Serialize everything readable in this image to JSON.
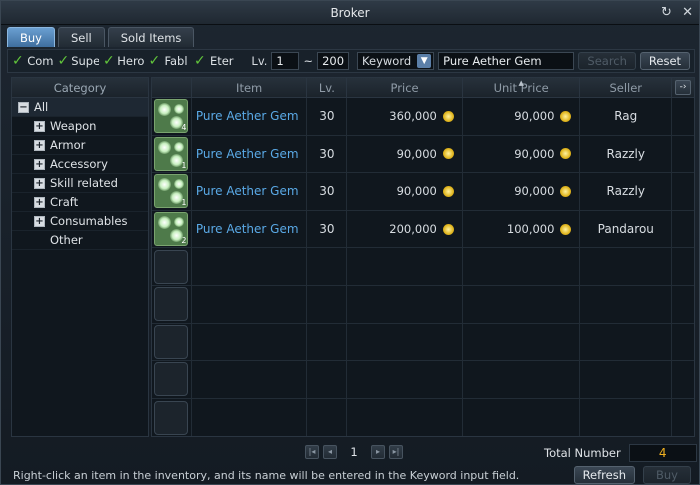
{
  "window": {
    "title": "Broker",
    "ctrl_restore": "↻",
    "ctrl_close": "✕"
  },
  "tabs": [
    {
      "label": "Buy",
      "active": true
    },
    {
      "label": "Sell",
      "active": false
    },
    {
      "label": "Sold Items",
      "active": false
    }
  ],
  "filters": {
    "checkboxes": [
      {
        "label": "Com",
        "checked": true
      },
      {
        "label": "Supe",
        "checked": true
      },
      {
        "label": "Hero",
        "checked": true
      },
      {
        "label": "Fabl",
        "checked": true
      },
      {
        "label": "Eter",
        "checked": true
      }
    ],
    "lv_label": "Lv.",
    "lv_min": "1",
    "lv_sep": "~",
    "lv_max": "200",
    "search_type": "Keyword",
    "keyword": "Pure Aether Gem",
    "search_label": "Search",
    "reset_label": "Reset"
  },
  "category": {
    "header": "Category",
    "items": [
      {
        "label": "All",
        "toggle": "−"
      },
      {
        "label": "Weapon",
        "toggle": "+"
      },
      {
        "label": "Armor",
        "toggle": "+"
      },
      {
        "label": "Accessory",
        "toggle": "+"
      },
      {
        "label": "Skill related",
        "toggle": "+"
      },
      {
        "label": "Craft",
        "toggle": "+"
      },
      {
        "label": "Consumables",
        "toggle": "+"
      },
      {
        "label": "Other",
        "toggle": ""
      }
    ]
  },
  "table": {
    "columns": {
      "item": "Item",
      "lv": "Lv.",
      "price": "Price",
      "unit_price": "Unit Price",
      "seller": "Seller",
      "more": "-›"
    },
    "rows": [
      {
        "icon": "aether-gem-icon",
        "qty": "4",
        "item": "Pure Aether Gem",
        "lv": "30",
        "price": "360,000",
        "unit_price": "90,000",
        "seller": "Rag"
      },
      {
        "icon": "aether-gem-icon",
        "qty": "1",
        "item": "Pure Aether Gem",
        "lv": "30",
        "price": "90,000",
        "unit_price": "90,000",
        "seller": "Razzly"
      },
      {
        "icon": "aether-gem-icon",
        "qty": "1",
        "item": "Pure Aether Gem",
        "lv": "30",
        "price": "90,000",
        "unit_price": "90,000",
        "seller": "Razzly"
      },
      {
        "icon": "aether-gem-icon",
        "qty": "2",
        "item": "Pure Aether Gem",
        "lv": "30",
        "price": "200,000",
        "unit_price": "100,000",
        "seller": "Pandarou"
      }
    ],
    "empty_rows": 5
  },
  "pager": {
    "first": "|◂",
    "prev": "◂",
    "page": "1",
    "next": "▸",
    "last": "▸|"
  },
  "total": {
    "label": "Total Number",
    "value": "4"
  },
  "hint": "Right-click an item in the inventory, and its name will be entered in the Keyword input field.",
  "buttons": {
    "refresh": "Refresh",
    "buy": "Buy"
  },
  "colors": {
    "item_link": "#5aa9e6",
    "total_value": "#f0b020",
    "check": "#61c43b",
    "active_tab": "#4f84b8"
  }
}
